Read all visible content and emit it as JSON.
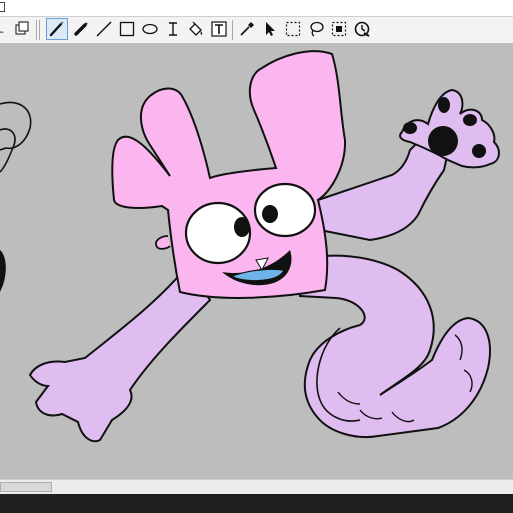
{
  "window": {
    "title": ""
  },
  "toolbar": {
    "tools": [
      {
        "name": "pen-tool",
        "icon": "pen-icon",
        "active": true
      },
      {
        "name": "marker-tool",
        "icon": "marker-icon",
        "active": false
      },
      {
        "name": "line-tool",
        "icon": "line-icon",
        "active": false
      },
      {
        "name": "rectangle-tool",
        "icon": "rectangle-icon",
        "active": false
      },
      {
        "name": "ellipse-tool",
        "icon": "ellipse-icon",
        "active": false
      },
      {
        "name": "text-cursor-tool",
        "icon": "text-cursor-icon",
        "active": false
      },
      {
        "name": "fill-bucket-tool",
        "icon": "paint-bucket-icon",
        "active": false
      },
      {
        "name": "text-box-tool",
        "icon": "text-box-icon",
        "active": false
      },
      {
        "name": "eyedropper-tool",
        "icon": "eyedropper-icon",
        "active": false
      },
      {
        "name": "pointer-tool",
        "icon": "cursor-arrow-icon",
        "active": false
      },
      {
        "name": "rect-select-tool",
        "icon": "marquee-icon",
        "active": false
      },
      {
        "name": "lasso-tool",
        "icon": "lasso-icon",
        "active": false
      },
      {
        "name": "magic-select-tool",
        "icon": "magic-select-icon",
        "active": false
      },
      {
        "name": "history-tool",
        "icon": "history-icon",
        "active": false
      }
    ]
  },
  "canvas": {
    "background_color": "#bdbdbd",
    "character_colors": {
      "head": "#fbb6ef",
      "body": "#e0bdf0",
      "outline": "#000000",
      "tongue": "#6fb4e8"
    }
  }
}
